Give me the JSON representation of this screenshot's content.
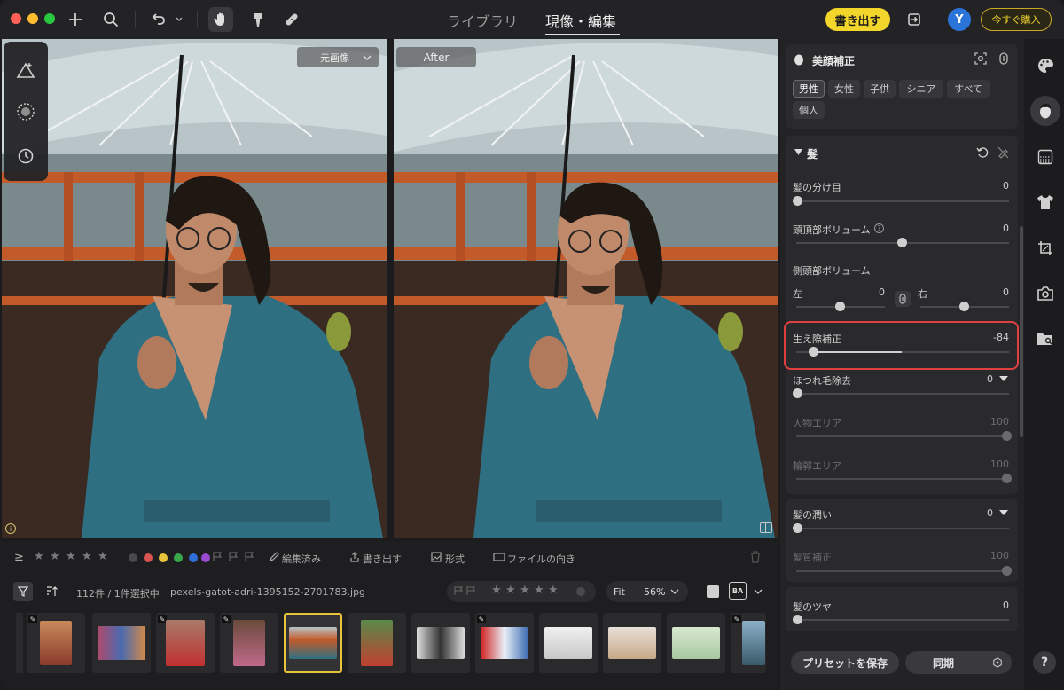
{
  "topbar": {
    "tabs": [
      {
        "label": "ライブラリ"
      },
      {
        "label": "現像・編集"
      }
    ],
    "export_label": "書き出す",
    "avatar_initial": "Y",
    "buy_label": "今すぐ購入"
  },
  "viewer": {
    "before_select": "元画像",
    "after_label": "After"
  },
  "panel": {
    "section_title": "美顔補正",
    "filters": [
      "男性",
      "女性",
      "子供",
      "シニア",
      "すべて",
      "個人"
    ],
    "selected_filter": "男性",
    "hair_title": "髪",
    "sliders": [
      {
        "label": "髪の分け目",
        "value": "0",
        "pos": 0.0
      },
      {
        "label": "頭頂部ボリューム",
        "value": "0",
        "pos": 0.5
      },
      {
        "label": "生え際補正",
        "value": "-84",
        "pos": 0.08
      }
    ],
    "side_volume": {
      "label": "側頭部ボリューム",
      "left_label": "左",
      "left_value": "0",
      "right_label": "右",
      "right_value": "0"
    },
    "stray_hair": {
      "label": "ほつれ毛除去",
      "value": "0"
    },
    "person_area": {
      "label": "人物エリア",
      "value": "100"
    },
    "outline_area": {
      "label": "輪郭エリア",
      "value": "100"
    },
    "hair_moisture": {
      "label": "髪の潤い",
      "value": "0"
    },
    "hair_texture": {
      "label": "髪質補正",
      "value": "100"
    },
    "hair_gloss": {
      "label": "髪のツヤ",
      "value": "0"
    },
    "save_preset": "プリセットを保存",
    "sync": "同期"
  },
  "toolbar": {
    "ge_symbol": "≥",
    "edited": "編集済み",
    "export": "書き出す",
    "format": "形式",
    "orientation": "ファイルの向き",
    "count": "112件 / 1件選択中",
    "filename": "pexels-gatot-adri-1395152-2701783.jpg",
    "fit": "Fit",
    "zoom": "56%",
    "ba": "BA"
  },
  "colors": {
    "accent_yellow": "#f3d62b",
    "highlight_red": "#e04040",
    "avatar_blue": "#2a74d9",
    "label_dots": [
      "#4a4a4e",
      "#d9534f",
      "#e8c43a",
      "#3aa84a",
      "#2e6fd8",
      "#9a4ad0"
    ]
  }
}
